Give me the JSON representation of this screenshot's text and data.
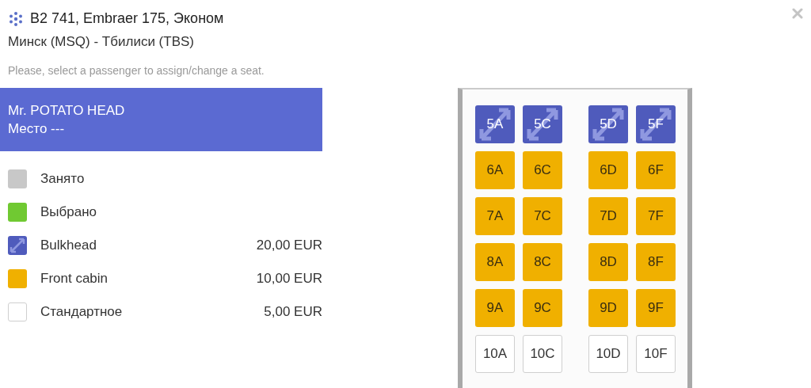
{
  "header": {
    "title": "B2 741, Embraer 175, Эконом",
    "route": "Минск (MSQ) - Тбилиси (TBS)",
    "hint": "Please, select a passenger to assign/change a seat."
  },
  "passengers": [
    {
      "name": "Mr. POTATO HEAD",
      "seat": "Место ---",
      "selected": true
    }
  ],
  "legend": [
    {
      "kind": "occupied",
      "label": "Занято"
    },
    {
      "kind": "chosen",
      "label": "Выбрано"
    },
    {
      "kind": "bulkhead",
      "label": "Bulkhead",
      "price": "20,00 EUR"
    },
    {
      "kind": "front",
      "label": "Front cabin",
      "price": "10,00 EUR"
    },
    {
      "kind": "standard",
      "label": "Стандартное",
      "price": "5,00 EUR"
    }
  ],
  "seat_rows": [
    {
      "seats": [
        {
          "label": "5A",
          "kind": "bulkhead"
        },
        {
          "label": "5C",
          "kind": "bulkhead"
        },
        {
          "label": "5D",
          "kind": "bulkhead"
        },
        {
          "label": "5F",
          "kind": "bulkhead"
        }
      ]
    },
    {
      "seats": [
        {
          "label": "6A",
          "kind": "front"
        },
        {
          "label": "6C",
          "kind": "front"
        },
        {
          "label": "6D",
          "kind": "front"
        },
        {
          "label": "6F",
          "kind": "front"
        }
      ]
    },
    {
      "seats": [
        {
          "label": "7A",
          "kind": "front"
        },
        {
          "label": "7C",
          "kind": "front"
        },
        {
          "label": "7D",
          "kind": "front"
        },
        {
          "label": "7F",
          "kind": "front"
        }
      ]
    },
    {
      "seats": [
        {
          "label": "8A",
          "kind": "front"
        },
        {
          "label": "8C",
          "kind": "front"
        },
        {
          "label": "8D",
          "kind": "front"
        },
        {
          "label": "8F",
          "kind": "front"
        }
      ]
    },
    {
      "seats": [
        {
          "label": "9A",
          "kind": "front"
        },
        {
          "label": "9C",
          "kind": "front"
        },
        {
          "label": "9D",
          "kind": "front"
        },
        {
          "label": "9F",
          "kind": "front"
        }
      ]
    },
    {
      "seats": [
        {
          "label": "10A",
          "kind": "standard"
        },
        {
          "label": "10C",
          "kind": "standard"
        },
        {
          "label": "10D",
          "kind": "standard"
        },
        {
          "label": "10F",
          "kind": "standard"
        }
      ]
    }
  ]
}
